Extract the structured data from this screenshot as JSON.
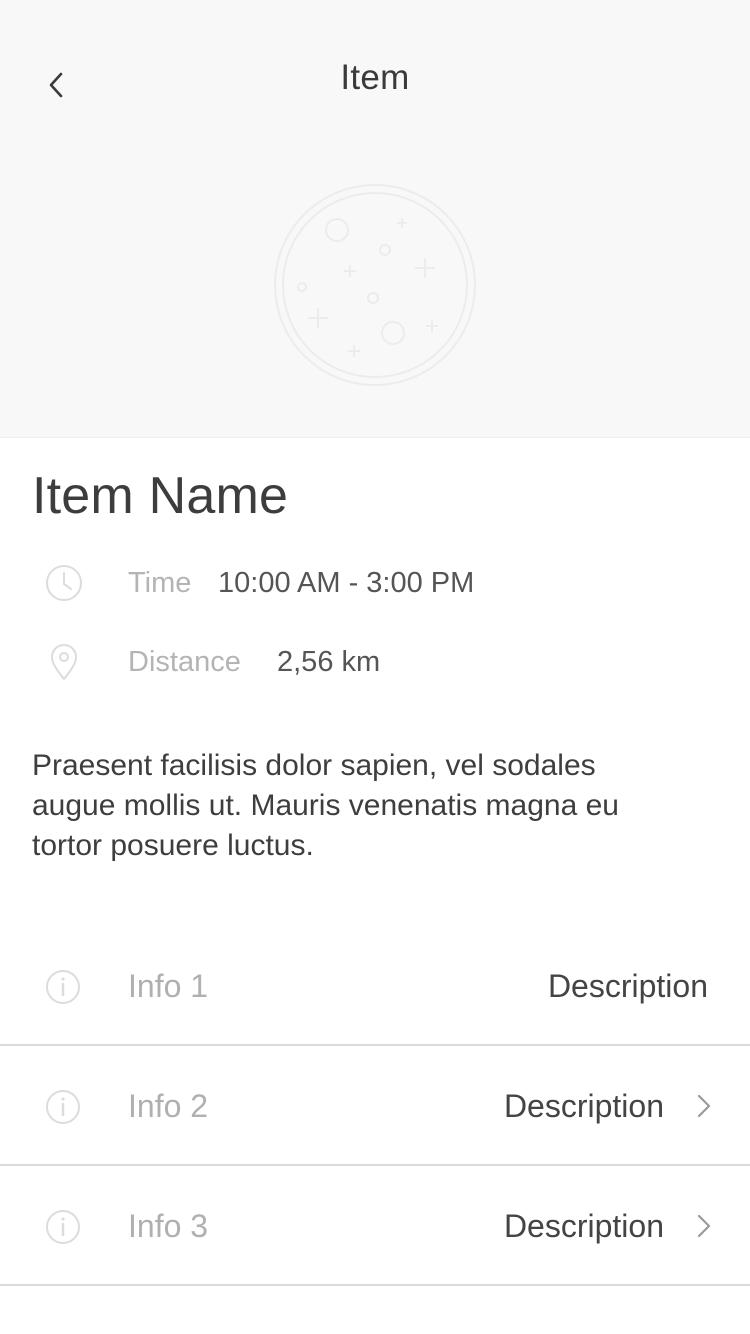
{
  "header": {
    "title": "Item",
    "back_icon": "chevron-left-icon"
  },
  "hero": {
    "image_icon": "placeholder-planet-image"
  },
  "item": {
    "name": "Item Name",
    "time": {
      "label": "Time",
      "value": "10:00 AM - 3:00 PM",
      "icon": "clock-icon"
    },
    "distance": {
      "label": "Distance",
      "value": "2,56 km",
      "icon": "location-pin-icon"
    },
    "description": "Praesent facilisis dolor sapien, vel sodales augue mollis ut. Mauris venenatis magna eu tortor posuere luctus."
  },
  "info_list": [
    {
      "label": "Info 1",
      "value": "Description",
      "icon": "info-icon",
      "has_chevron": false
    },
    {
      "label": "Info 2",
      "value": "Description",
      "icon": "info-icon",
      "has_chevron": true
    },
    {
      "label": "Info 3",
      "value": "Description",
      "icon": "info-icon",
      "has_chevron": true
    }
  ],
  "colors": {
    "hero_background": "#f8f8f8",
    "divider": "#dadada",
    "muted_text": "#b4b4b4",
    "primary_text": "#3d3d3d"
  }
}
